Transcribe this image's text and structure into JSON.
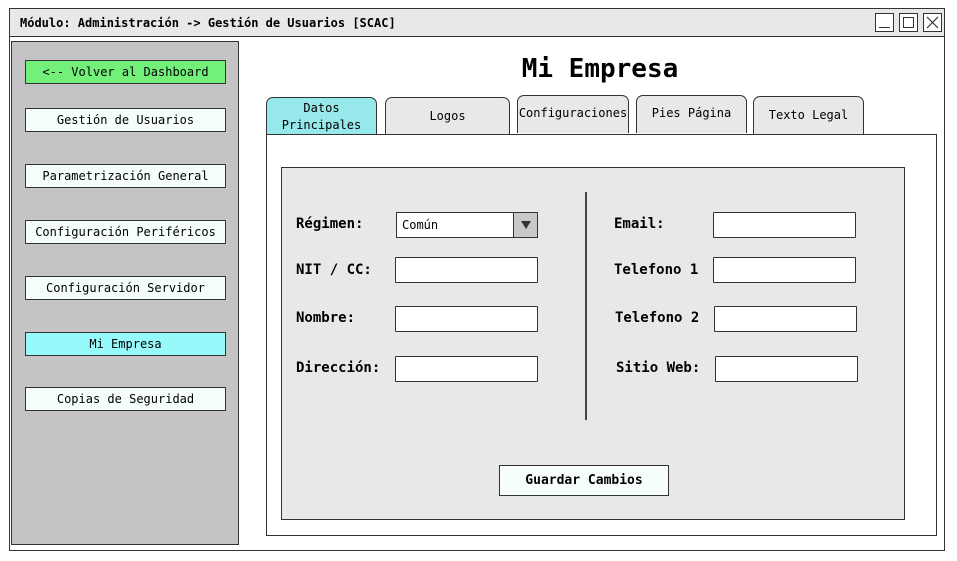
{
  "window": {
    "title": "Módulo: Administración -> Gestión de Usuarios [SCAC]"
  },
  "sidebar": {
    "back_label": "<-- Volver al Dashboard",
    "items": [
      {
        "label": "Gestión de Usuarios"
      },
      {
        "label": "Parametrización General"
      },
      {
        "label": "Configuración Periféricos"
      },
      {
        "label": "Configuración Servidor"
      },
      {
        "label": "Mi Empresa"
      },
      {
        "label": "Copias de Seguridad"
      }
    ],
    "active_item": "Mi Empresa"
  },
  "main": {
    "title": "Mi Empresa",
    "tabs": [
      {
        "line1": "Datos",
        "line2": "Principales"
      },
      {
        "line1": "Logos",
        "line2": ""
      },
      {
        "line1": "Configuraciones",
        "line2": ""
      },
      {
        "line1": "Pies Página",
        "line2": ""
      },
      {
        "line1": "Texto Legal",
        "line2": ""
      }
    ],
    "active_tab": "Datos Principales"
  },
  "form": {
    "regimen_label": "Régimen:",
    "regimen_value": "Común",
    "nit_label": "NIT / CC:",
    "nit_value": "",
    "nombre_label": "Nombre:",
    "nombre_value": "",
    "direccion_label": "Dirección:",
    "direccion_value": "",
    "email_label": "Email:",
    "email_value": "",
    "telefono1_label": "Telefono 1",
    "telefono1_value": "",
    "telefono2_label": "Telefono 2",
    "telefono2_value": "",
    "sitio_web_label": "Sitio Web:",
    "sitio_web_value": "",
    "save_label": "Guardar Cambios"
  },
  "colors": {
    "back_button": "#72f07a",
    "active_item": "#96fafa",
    "active_tab": "#96e8ea",
    "sidebar_bg": "#c4c4c4",
    "panel_bg": "#e8e8e8"
  }
}
